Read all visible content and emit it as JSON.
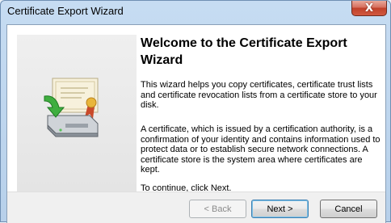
{
  "window": {
    "title": "Certificate Export Wizard",
    "close_glyph": "X"
  },
  "heading": "Welcome to the Certificate Export Wizard",
  "paragraphs": [
    "This wizard helps you copy certificates, certificate trust lists and certificate revocation lists from a certificate store to your disk.",
    "A certificate, which is issued by a certification authority, is a confirmation of your identity and contains information used to protect data or to establish secure network connections. A certificate store is the system area where certificates are kept.",
    "To continue, click Next."
  ],
  "buttons": {
    "back": "< Back",
    "next": "Next >",
    "cancel": "Cancel"
  },
  "icons": {
    "wizard_illustration": "certificate-export-illustration-icon",
    "close": "close-icon"
  },
  "colors": {
    "titlebar": "#c6dcf2",
    "close": "#c0412a",
    "next_border": "#3c7fb1"
  }
}
